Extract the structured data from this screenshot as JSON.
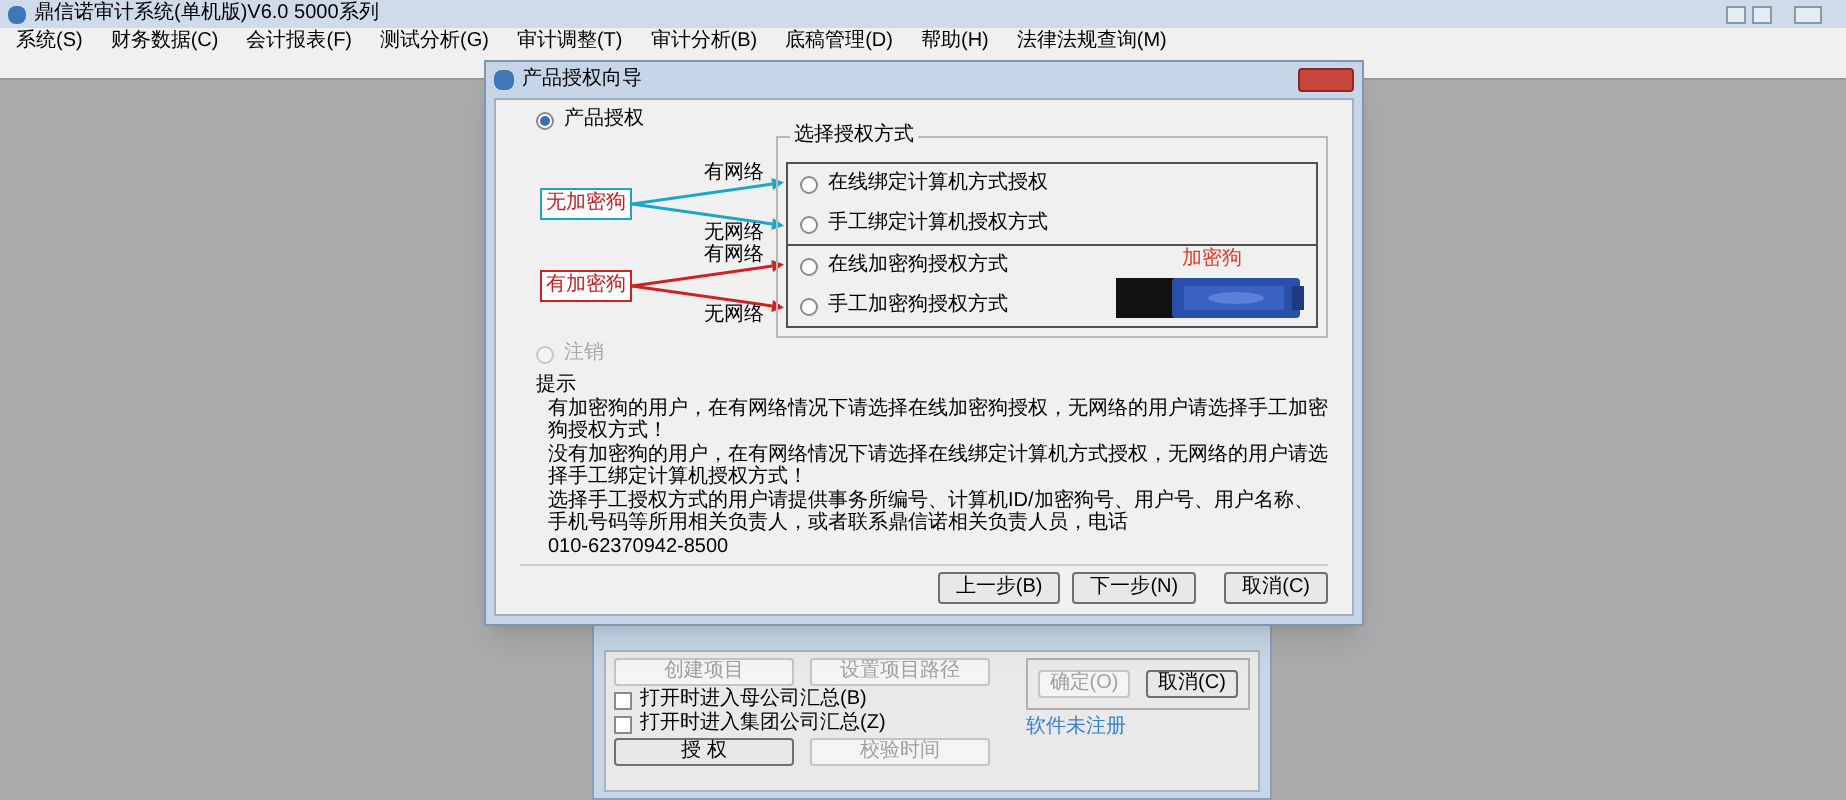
{
  "window": {
    "title": "鼎信诺审计系统(单机版)V6.0 5000系列"
  },
  "menu": [
    "系统(S)",
    "财务数据(C)",
    "会计报表(F)",
    "测试分析(G)",
    "审计调整(T)",
    "审计分析(B)",
    "底稿管理(D)",
    "帮助(H)",
    "法律法规查询(M)"
  ],
  "dialog": {
    "title": "产品授权向导",
    "modes": [
      {
        "label": "产品授权",
        "selected": true,
        "disabled": false
      },
      {
        "label": "注销",
        "selected": false,
        "disabled": true
      }
    ],
    "auth_group": {
      "title": "选择授权方式",
      "sections": [
        {
          "dongle_label": "无加密狗",
          "color": "#1aa6c8",
          "items": [
            {
              "network": "有网络",
              "label": "在线绑定计算机方式授权",
              "selected": false
            },
            {
              "network": "无网络",
              "label": "手工绑定计算机授权方式",
              "selected": false
            }
          ]
        },
        {
          "dongle_label": "有加密狗",
          "color": "#d02020",
          "picture_caption": "加密狗",
          "items": [
            {
              "network": "有网络",
              "label": "在线加密狗授权方式",
              "selected": false
            },
            {
              "network": "无网络",
              "label": "手工加密狗授权方式",
              "selected": false
            }
          ]
        }
      ]
    },
    "hint": {
      "title": "提示",
      "paragraphs": [
        "有加密狗的用户，在有网络情况下请选择在线加密狗授权，无网络的用户请选择手工加密狗授权方式！",
        "没有加密狗的用户，在有网络情况下请选择在线绑定计算机方式授权，无网络的用户请选择手工绑定计算机授权方式！",
        "选择手工授权方式的用户请提供事务所编号、计算机ID/加密狗号、用户号、用户名称、手机号码等所用相关负责人，或者联系鼎信诺相关负责人员，电话",
        "010-62370942-8500"
      ]
    },
    "buttons": [
      {
        "label": "上一步(B)",
        "disabled": false
      },
      {
        "label": "下一步(N)",
        "disabled": false
      },
      {
        "label": "取消(C)",
        "disabled": false
      }
    ]
  },
  "back_dialog": {
    "project_buttons": [
      {
        "label": "创建项目",
        "disabled": true
      },
      {
        "label": "设置项目路径",
        "disabled": true
      }
    ],
    "checkboxes": [
      {
        "label": "打开时进入母公司汇总(B)",
        "checked": false
      },
      {
        "label": "打开时进入集团公司汇总(Z)",
        "checked": false
      }
    ],
    "auth_buttons": [
      {
        "label": "授 权",
        "disabled": false
      },
      {
        "label": "校验时间",
        "disabled": true
      }
    ],
    "confirm_buttons": [
      {
        "label": "确定(O)",
        "disabled": true
      },
      {
        "label": "取消(C)",
        "disabled": false
      }
    ],
    "link": "软件未注册"
  }
}
